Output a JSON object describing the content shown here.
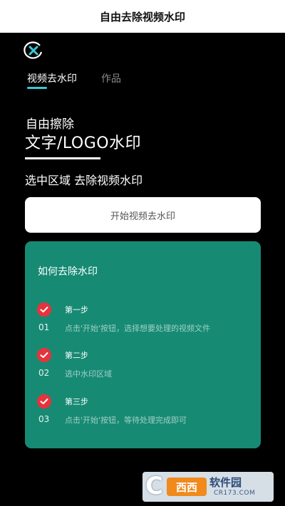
{
  "caption": "自由去除视频水印",
  "app": {
    "logo_icon": "x-circle-logo-icon",
    "accent_color": "#38c9d6"
  },
  "tabs": [
    {
      "label": "视频去水印",
      "active": true
    },
    {
      "label": "作品",
      "active": false
    }
  ],
  "hero": {
    "line1": "自由擦除",
    "line2": "文字/LOGO水印",
    "line3": "选中区域 去除视频水印"
  },
  "start_button": {
    "label": "开始视频去水印"
  },
  "guide": {
    "title": "如何去除水印",
    "card_color": "#178a74",
    "check_color": "#e8323c",
    "steps": [
      {
        "title": "第一步",
        "number": "01",
        "description": "点击'开始'按钮，选择想要处理的视频文件"
      },
      {
        "title": "第二步",
        "number": "02",
        "description": "选中水印区域"
      },
      {
        "title": "第三步",
        "number": "03",
        "description": "点击'开始'按钮，等待处理完成即可"
      }
    ]
  },
  "watermark": {
    "mark": "C",
    "badge": "西西",
    "name": "软件园",
    "url": "CR173.COM"
  }
}
